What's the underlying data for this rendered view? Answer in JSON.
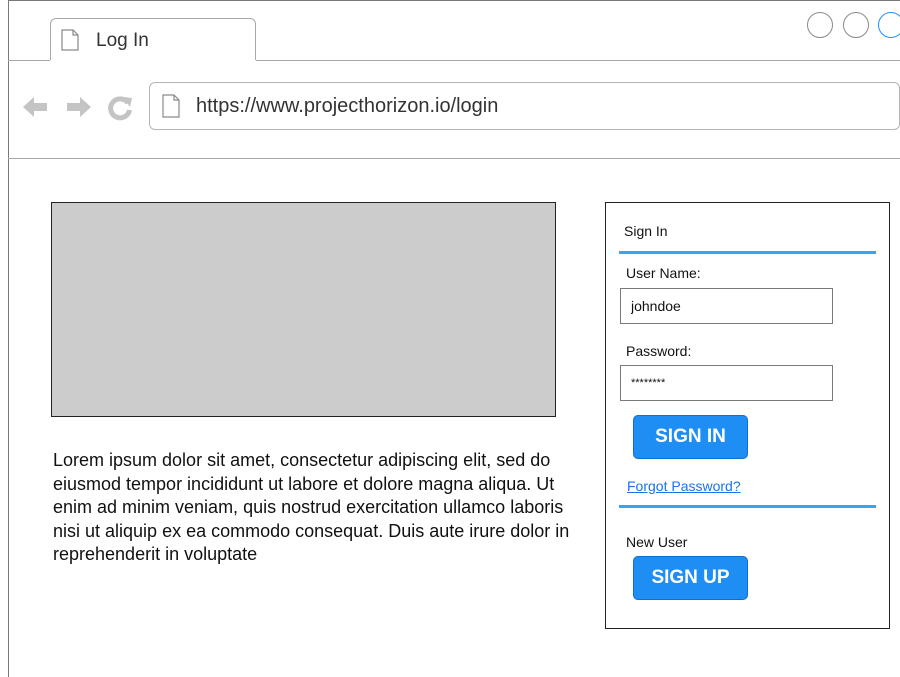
{
  "browser": {
    "tab_title": "Log In",
    "url": "https://www.projecthorizon.io/login",
    "accent_color": "#1e90ff"
  },
  "toolbar": {
    "icons": [
      "back-arrow-icon",
      "forward-arrow-icon",
      "reload-icon"
    ]
  },
  "main": {
    "paragraph": "Lorem ipsum dolor sit amet, consectetur adipiscing elit, sed do eiusmod tempor incididunt ut labore et dolore magna aliqua. Ut enim ad minim veniam, quis nostrud exercitation ullamco laboris nisi ut aliquip ex ea commodo consequat. Duis aute irure dolor in reprehenderit in voluptate"
  },
  "signin": {
    "title": "Sign In",
    "username_label": "User Name:",
    "username_value": "johndoe",
    "password_label": "Password:",
    "password_value": "********",
    "signin_button": "SIGN IN",
    "forgot_link": "Forgot Password?",
    "new_user_label": "New User",
    "signup_button": "SIGN UP",
    "button_color": "#1e8ef5",
    "rule_color": "#3aa3f0"
  }
}
